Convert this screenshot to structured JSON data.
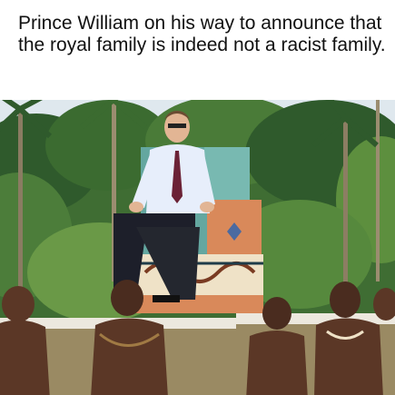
{
  "caption": {
    "text": "Prince William on his way to announce that the royal family is indeed not a racist family."
  },
  "photo": {
    "subject_icon": "photo-image",
    "colors": {
      "sky": "#dfe8ee",
      "palm_dark": "#2f5a2c",
      "palm_light": "#5d8f3e",
      "ground": "#9a8a63",
      "shirt": "#e7eefb",
      "trousers": "#1d1f2a",
      "tie": "#6b2236",
      "skin_light": "#e2b594",
      "skin_dark": "#5b3726",
      "throne_teal": "#64a7a0",
      "throne_orange": "#d9895a",
      "throne_cream": "#efe2c7",
      "pole_white": "#ece8de"
    }
  }
}
